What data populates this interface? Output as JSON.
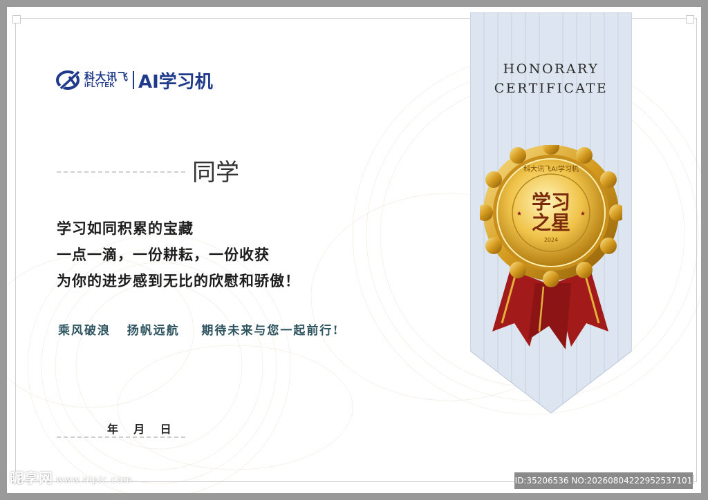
{
  "logo": {
    "brand_cn": "科大讯飞",
    "brand_en": "iFLYTEK",
    "product": "AI学习机"
  },
  "recipient_suffix": "同学",
  "body_lines": [
    "学习如同积累的宝藏",
    "一点一滴，一份耕耘，一份收获",
    "为你的进步感到无比的欣慰和骄傲！"
  ],
  "wish_line": "乘风破浪   扬帆远航    期待未来与您一起前行!",
  "date_label": "年    月    日",
  "ribbon": {
    "title_line1": "HONORARY",
    "title_line2": "CERTIFICATE"
  },
  "medal": {
    "ring_text": "科大讯飞AI学习机",
    "title_top": "学习",
    "title_bottom": "之星",
    "year": "2024"
  },
  "watermark": {
    "site_name": "昵享网",
    "site_url": "www.nipic.com",
    "id_text": "ID:35206536 NO:20260804222952537101"
  },
  "colors": {
    "brand_blue": "#1f3a8a",
    "ribbon_blue": "#dde6f0",
    "gold": "#e3b23c",
    "medal_red": "#a31a1a",
    "wish_teal": "#2e5460"
  }
}
